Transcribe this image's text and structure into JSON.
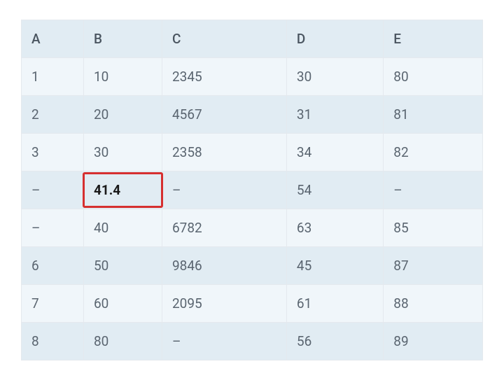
{
  "table": {
    "headers": [
      "A",
      "B",
      "C",
      "D",
      "E"
    ],
    "rows": [
      {
        "A": "1",
        "B": "10",
        "C": "2345",
        "D": "30",
        "E": "80"
      },
      {
        "A": "2",
        "B": "20",
        "C": "4567",
        "D": "31",
        "E": "81"
      },
      {
        "A": "3",
        "B": "30",
        "C": "2358",
        "D": "34",
        "E": "82"
      },
      {
        "A": "–",
        "B": "41.4",
        "C": "–",
        "D": "54",
        "E": "–"
      },
      {
        "A": "–",
        "B": "40",
        "C": "6782",
        "D": "63",
        "E": "85"
      },
      {
        "A": "6",
        "B": "50",
        "C": "9846",
        "D": "45",
        "E": "87"
      },
      {
        "A": "7",
        "B": "60",
        "C": "2095",
        "D": "61",
        "E": "88"
      },
      {
        "A": "8",
        "B": "80",
        "C": "–",
        "D": "56",
        "E": "89"
      }
    ],
    "highlight": {
      "row": 3,
      "col": "B"
    }
  }
}
